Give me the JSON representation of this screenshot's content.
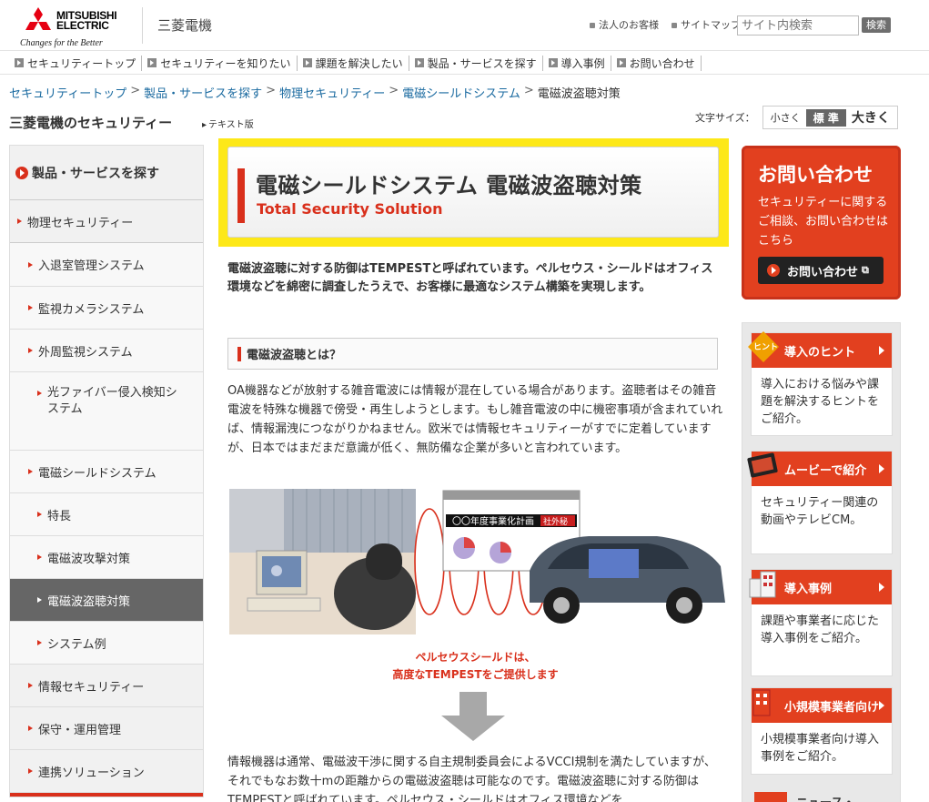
{
  "header": {
    "logo_line1": "MITSUBISHI",
    "logo_line2": "ELECTRIC",
    "tagline": "Changes for the Better",
    "brand_jp": "三菱電機",
    "util_links": [
      "法人のお客様",
      "サイトマップ"
    ],
    "search_placeholder": "サイト内検索",
    "search_button": "検索"
  },
  "gnav": [
    "セキュリティートップ",
    "セキュリティーを知りたい",
    "課題を解決したい",
    "製品・サービスを探す",
    "導入事例",
    "お問い合わせ"
  ],
  "breadcrumb": [
    "セキュリティートップ",
    "製品・サービスを探す",
    "物理セキュリティー",
    "電磁シールドシステム"
  ],
  "breadcrumb_current": "電磁波盗聴対策",
  "breadcrumb_sep": ">",
  "page_title": "三菱電機のセキュリティー",
  "text_version": "テキスト版",
  "font_size": {
    "label": "文字サイズ：",
    "small": "小さく",
    "normal": "標 準",
    "large": "大きく"
  },
  "sidebar": {
    "head": "製品・サービスを探す",
    "section": "物理セキュリティー",
    "items": [
      "入退室管理システム",
      "監視カメラシステム",
      "外周監視システム",
      "光ファイバー侵入検知システム",
      "電磁シールドシステム",
      "特長",
      "電磁波攻撃対策",
      "電磁波盗聴対策",
      "システム例",
      "情報セキュリティー",
      "保守・運用管理",
      "連携ソリューション"
    ]
  },
  "hero": {
    "title": "電磁シールドシステム 電磁波盗聴対策",
    "subtitle": "Total Security Solution"
  },
  "lead": "電磁波盗聴に対する防御はTEMPESTと呼ばれています。ペルセウス・シールドはオフィス環境などを綿密に調査したうえで、お客様に最適なシステム構築を実現します。",
  "section_head": "電磁波盗聴とは？",
  "body1": "OA機器などが放射する雑音電波には情報が混在している場合があります。盗聴者はその雑音電波を特殊な機器で傍受・再生しようとします。もし雑音電波の中に機密事項が含まれていれば、情報漏洩につながりかねません。欧米では情報セキュリティーがすでに定着していますが、日本ではまだまだ意識が低く、無防備な企業が多いと言われています。",
  "illus": {
    "doc_title": "〇〇年度事業化計画",
    "doc_stamp": "社外秘"
  },
  "caption_line1": "ペルセウスシールドは、",
  "caption_line2": "高度なTEMPESTをご提供します",
  "body2": "情報機器は通常、電磁波干渉に関する自主規制委員会によるVCCI規制を満たしていますが、それでもなお数十mの距離からの電磁波盗聴は可能なのです。電磁波盗聴に対する防御はTEMPESTと呼ばれています。ペルセウス・シールドはオフィス環境などを",
  "contact": {
    "title": "お問い合わせ",
    "desc": "セキュリティーに関するご相談、お問い合わせはこちら",
    "button": "お問い合わせ"
  },
  "right_cards": [
    {
      "title": "導入のヒント",
      "text": "導入における悩みや課題を解決するヒントをご紹介。",
      "icon_label": "ヒント"
    },
    {
      "title": "ムービーで紹介",
      "text": "セキュリティー関連の動画やテレビCM。"
    },
    {
      "title": "導入事例",
      "text": "課題や事業者に応じた導入事例をご紹介。"
    },
    {
      "title": "小規模事業者向け",
      "text": "小規模事業者向け導入事例をご紹介。"
    },
    {
      "title": "ニュース・"
    }
  ],
  "colors": {
    "accent_red": "#d9301c",
    "hero_yellow": "#fde818",
    "link_blue": "#1a6aa0"
  }
}
